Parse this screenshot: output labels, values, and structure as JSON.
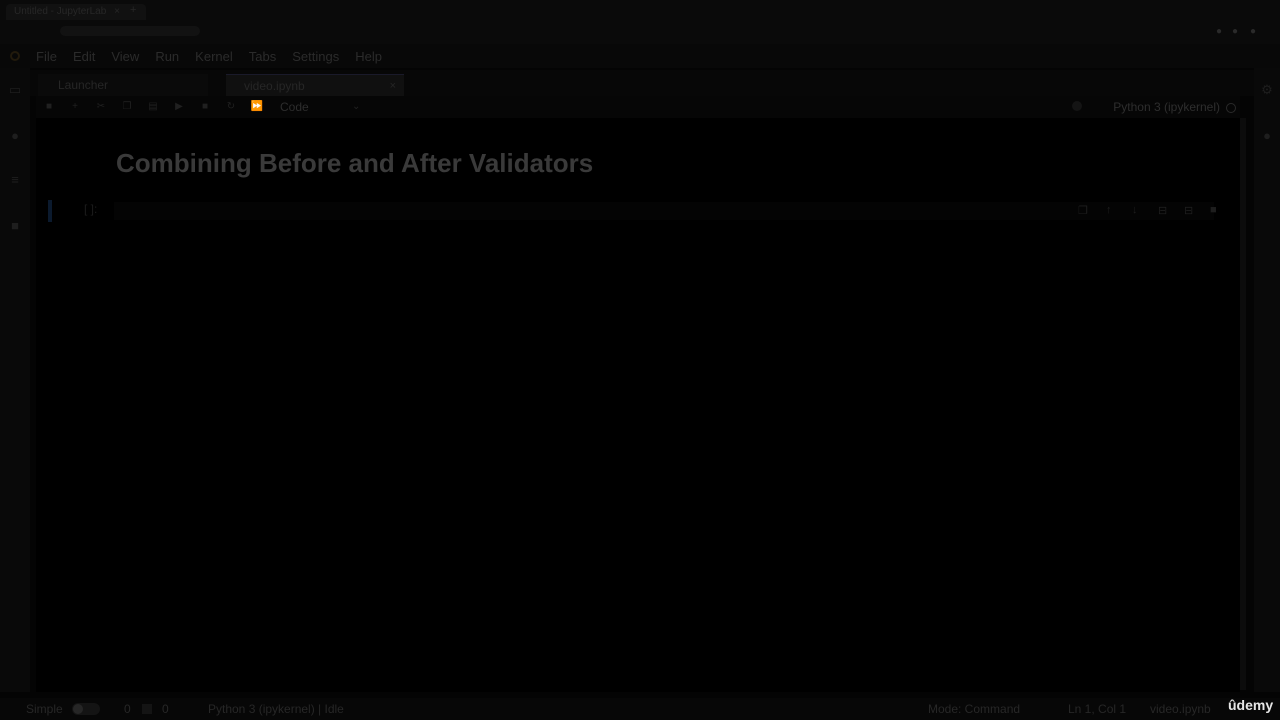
{
  "browser": {
    "tab_title": "Untitled - JupyterLab",
    "tab_close": "×",
    "tab_add": "+"
  },
  "menu": {
    "items": [
      "File",
      "Edit",
      "View",
      "Run",
      "Kernel",
      "Tabs",
      "Settings",
      "Help"
    ]
  },
  "doc_tabs": [
    {
      "label": "Launcher"
    },
    {
      "label": "video.ipynb",
      "close": "×"
    }
  ],
  "toolbar": {
    "cell_type": "Code",
    "cell_type_chevron": "⌄",
    "kernel_name": "Python 3 (ipykernel)"
  },
  "notebook": {
    "heading": "Combining Before and After Validators",
    "cell_prompt": "[ ]:"
  },
  "status_bar": {
    "simple_label": "Simple",
    "counter_a": "0",
    "counter_b": "0",
    "kernel_status": "Python 3 (ipykernel) | Idle",
    "mode": "Mode: Command",
    "position": "Ln 1, Col 1",
    "file_name": "video.ipynb"
  },
  "watermark": {
    "brand": "ûdemy"
  },
  "icons": {
    "save": "save-icon",
    "add": "add-icon",
    "cut": "cut-icon",
    "copy": "copy-icon",
    "paste": "paste-icon",
    "run": "run-icon",
    "stop": "stop-icon",
    "restart": "restart-icon",
    "fast-forward": "fast-forward-icon"
  }
}
